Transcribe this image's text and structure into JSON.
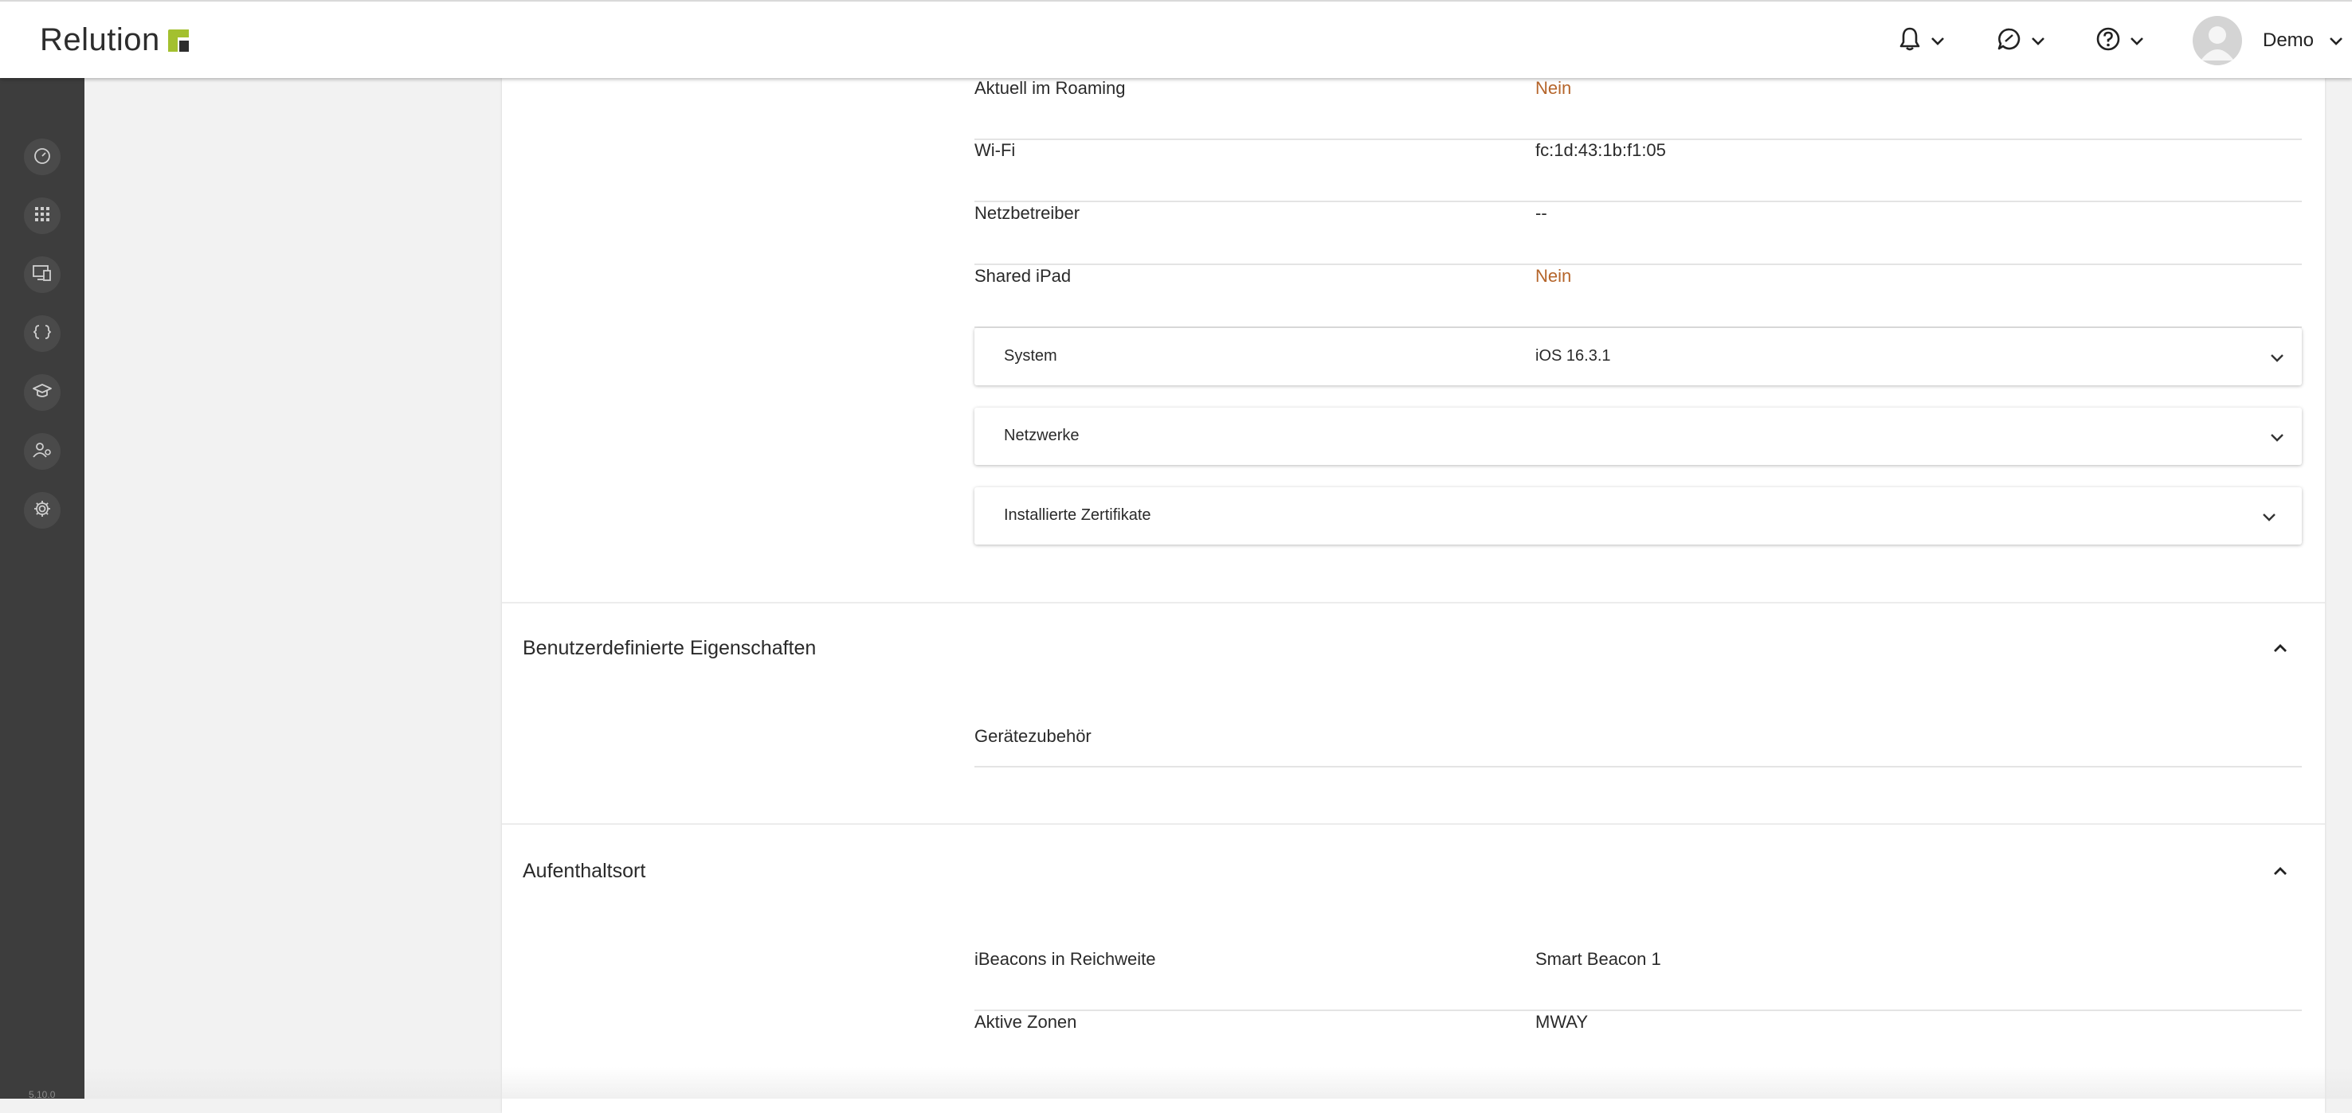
{
  "header": {
    "app_name": "Relution",
    "user_name": "Demo"
  },
  "sidebar": {
    "items": [
      {
        "icon": "dashboard-icon"
      },
      {
        "icon": "apps-grid-icon"
      },
      {
        "icon": "devices-icon"
      },
      {
        "icon": "code-braces-icon"
      },
      {
        "icon": "education-cap-icon"
      },
      {
        "icon": "users-icon"
      },
      {
        "icon": "settings-gear-icon"
      }
    ],
    "version": "5.10.0"
  },
  "details": {
    "rows": [
      {
        "label": "Aktuell im Roaming",
        "value": "Nein"
      },
      {
        "label": "Wi-Fi",
        "value": "fc:1d:43:1b:f1:05"
      },
      {
        "label": "Netzbetreiber",
        "value": "--"
      },
      {
        "label": "Shared iPad",
        "value": "Nein"
      }
    ],
    "panels": [
      {
        "label": "System",
        "value": "iOS 16.3.1"
      },
      {
        "label": "Netzwerke",
        "value": ""
      },
      {
        "label": "Installierte Zertifikate",
        "value": ""
      }
    ]
  },
  "custom_properties": {
    "title": "Benutzerdefinierte Eigenschaften",
    "rows": [
      {
        "label": "Gerätezubehör",
        "value": ""
      }
    ]
  },
  "location": {
    "title": "Aufenthaltsort",
    "rows": [
      {
        "label": "iBeacons in Reichweite",
        "value": "Smart Beacon 1"
      },
      {
        "label": "Aktive Zonen",
        "value": "MWAY"
      }
    ]
  },
  "colors": {
    "accent_orange": "#b5652b",
    "sidebar_bg": "#3d3d3d",
    "logo_green": "#a3c02f"
  }
}
